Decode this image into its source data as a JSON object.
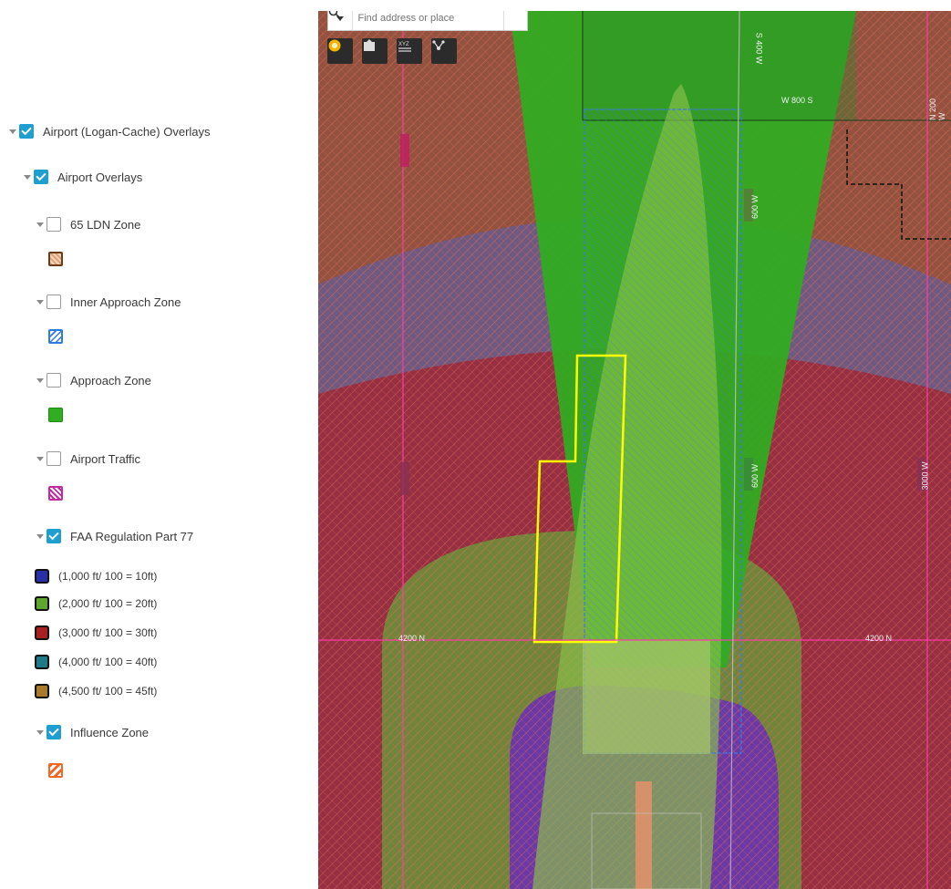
{
  "legend": {
    "root": {
      "label": "Airport (Logan-Cache) Overlays",
      "checked": true
    },
    "group": {
      "label": "Airport Overlays",
      "checked": true
    },
    "layers": {
      "ldn": {
        "label": "65 LDN Zone",
        "checked": false,
        "symbol": "ldn-hatch-icon"
      },
      "inner": {
        "label": "Inner Approach Zone",
        "checked": false,
        "symbol": "inner-approach-hatch-icon"
      },
      "approach": {
        "label": "Approach Zone",
        "checked": false,
        "symbol": "approach-fill-icon"
      },
      "traffic": {
        "label": "Airport Traffic",
        "checked": false,
        "symbol": "traffic-hatch-icon"
      },
      "faa": {
        "label": "FAA Regulation Part 77",
        "checked": true,
        "classes": [
          {
            "label": "(1,000 ft/ 100 = 10ft)",
            "color": "#2a2fa8"
          },
          {
            "label": "(2,000 ft/ 100 = 20ft)",
            "color": "#5fa62e"
          },
          {
            "label": "(3,000 ft/ 100 = 30ft)",
            "color": "#a82020"
          },
          {
            "label": "(4,000 ft/ 100 = 40ft)",
            "color": "#1e7a86"
          },
          {
            "label": "(4,500 ft/ 100 = 45ft)",
            "color": "#a87a2a"
          }
        ]
      },
      "influence": {
        "label": "Influence Zone",
        "checked": true,
        "symbol": "influence-hatch-icon"
      }
    }
  },
  "map": {
    "search": {
      "placeholder": "Find address or place"
    },
    "tools": [
      "basemap-icon",
      "print-icon",
      "xy-coordinate-icon",
      "share-icon"
    ],
    "road_labels": {
      "s400w": "S 400 W",
      "w800s": "W 800 S",
      "n200w": "N 200 W",
      "r600w_a": "600 W",
      "r600w_b": "600 W",
      "r4200n_a": "4200 N",
      "r4200n_b": "4200 N",
      "r3000w": "3000 W"
    },
    "colors": {
      "faa_10": "#2a2fa8",
      "faa_20": "#5fa62e",
      "faa_30": "#a82020",
      "faa_45": "#a87a2a",
      "approach": "#2fae1f",
      "parcel_outline": "#ffff00"
    }
  }
}
